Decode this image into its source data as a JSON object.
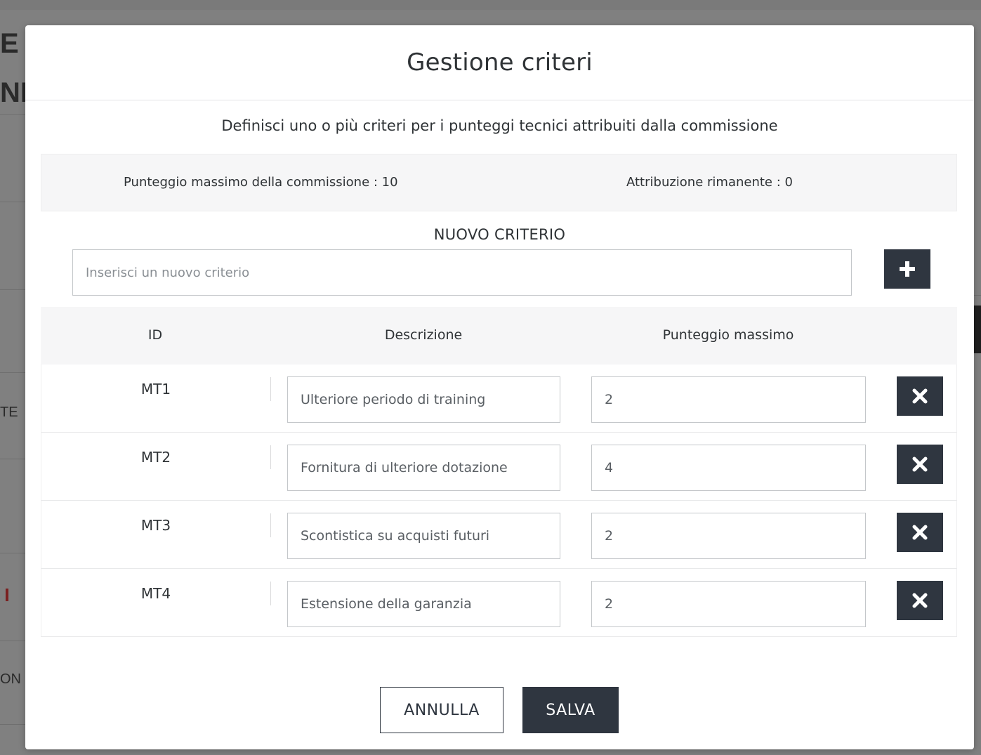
{
  "background": {
    "fragments": [
      "E",
      "NE",
      "TE",
      "",
      "ON"
    ]
  },
  "modal": {
    "title": "Gestione criteri",
    "subtitle": "Definisci uno o più criteri per i punteggi tecnici attribuiti dalla commissione",
    "info": {
      "max_score_label": "Punteggio massimo della commissione : 10",
      "remaining_label": "Attribuzione rimanente : 0"
    },
    "new_criterion": {
      "title": "NUOVO CRITERIO",
      "placeholder": "Inserisci un nuovo criterio",
      "value": "",
      "add_icon": "plus-icon"
    },
    "table": {
      "headers": [
        "ID",
        "Descrizione",
        "Punteggio massimo"
      ],
      "rows": [
        {
          "id": "MT1",
          "description": "Ulteriore periodo di training",
          "max_score": "2"
        },
        {
          "id": "MT2",
          "description": "Fornitura di ulteriore dotazione",
          "max_score": "4"
        },
        {
          "id": "MT3",
          "description": "Scontistica su acquisti futuri",
          "max_score": "2"
        },
        {
          "id": "MT4",
          "description": "Estensione della garanzia",
          "max_score": "2"
        }
      ],
      "delete_icon": "close-icon"
    },
    "footer": {
      "cancel_label": "ANNULLA",
      "save_label": "SALVA"
    }
  },
  "colors": {
    "dark_button": "#2f3640",
    "overlay": "#808080",
    "text": "#2f3336"
  }
}
